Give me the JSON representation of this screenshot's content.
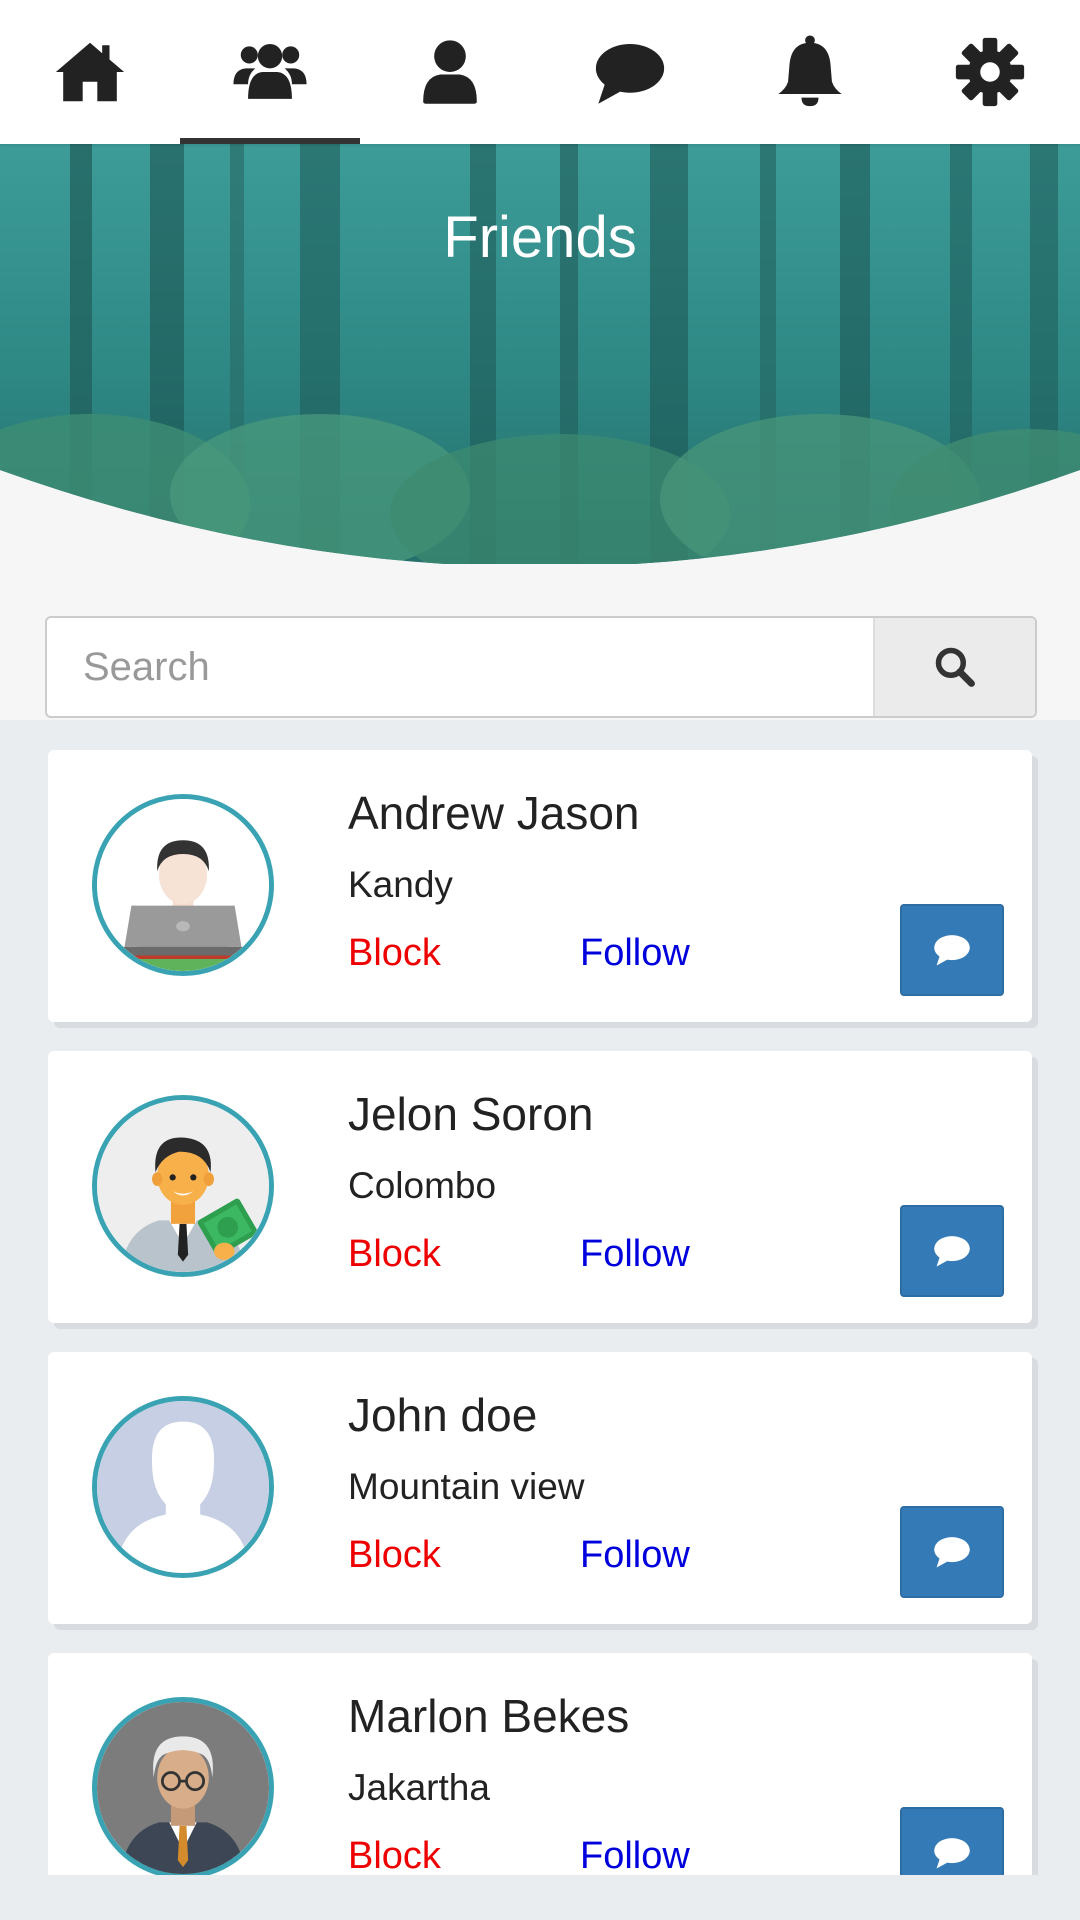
{
  "nav": {
    "tabs": [
      {
        "icon": "home-icon",
        "active": false
      },
      {
        "icon": "friends-icon",
        "active": true
      },
      {
        "icon": "profile-icon",
        "active": false
      },
      {
        "icon": "chat-icon",
        "active": false
      },
      {
        "icon": "bell-icon",
        "active": false
      },
      {
        "icon": "gear-icon",
        "active": false
      }
    ]
  },
  "header": {
    "title": "Friends"
  },
  "search": {
    "placeholder": "Search",
    "value": "",
    "button_icon": "search-icon"
  },
  "friends": [
    {
      "name": "Andrew Jason",
      "city": "Kandy",
      "block_label": "Block",
      "follow_label": "Follow",
      "avatar": "man-with-laptop",
      "message_icon": "comment-icon"
    },
    {
      "name": "Jelon Soron",
      "city": "Colombo",
      "block_label": "Block",
      "follow_label": "Follow",
      "avatar": "businessman-with-money",
      "message_icon": "comment-icon"
    },
    {
      "name": "John doe",
      "city": "Mountain view",
      "block_label": "Block",
      "follow_label": "Follow",
      "avatar": "default-silhouette",
      "message_icon": "comment-icon"
    },
    {
      "name": "Marlon Bekes",
      "city": "Jakartha",
      "block_label": "Block",
      "follow_label": "Follow",
      "avatar": "older-man-glasses",
      "message_icon": "comment-icon"
    }
  ],
  "colors": {
    "nav_icon": "#222222",
    "hero_teal": "#2e8d8a",
    "avatar_ring": "#3aa3b3",
    "block_text": "#ee0000",
    "follow_text": "#0000dd",
    "message_button": "#337ab7",
    "page_background": "#e9edf0"
  }
}
